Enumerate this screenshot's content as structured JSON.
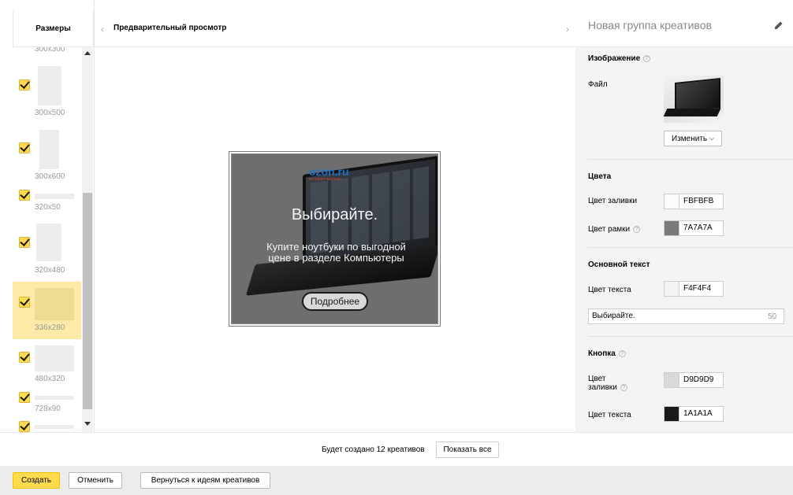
{
  "sizes_panel": {
    "title": "Размеры",
    "items": [
      {
        "label": "300x300",
        "checked": true,
        "selected": false
      },
      {
        "label": "300x500",
        "checked": true,
        "selected": false
      },
      {
        "label": "300x600",
        "checked": true,
        "selected": false
      },
      {
        "label": "320x50",
        "checked": true,
        "selected": false
      },
      {
        "label": "320x480",
        "checked": true,
        "selected": false
      },
      {
        "label": "336x280",
        "checked": true,
        "selected": true
      },
      {
        "label": "480x320",
        "checked": true,
        "selected": false
      },
      {
        "label": "728x90",
        "checked": true,
        "selected": false
      },
      {
        "label": "",
        "checked": true,
        "selected": false
      }
    ]
  },
  "preview": {
    "title": "Предварительный просмотр",
    "prev_icon": "chevron-left-icon",
    "next_icon": "chevron-right-icon",
    "ad": {
      "logo": "ozon.ru",
      "logo_sub": "интернет-магазин",
      "headline": "Выбирайте.",
      "body": "Купите ноутбуки по выгодной цене в разделе Компьютеры",
      "button": "Подробнее",
      "fill_color": "#FBFBFB",
      "border_color": "#7A7A7A",
      "text_color": "#F4F4F4",
      "button_fill": "#D9D9D9",
      "button_text": "#1A1A1A"
    }
  },
  "settings": {
    "title": "Новая группа креативов",
    "edit_icon": "pencil-icon",
    "image": {
      "section_title": "Изображение",
      "file_label": "Файл",
      "change_button": "Изменить"
    },
    "colors": {
      "section_title": "Цвета",
      "fill_label": "Цвет заливки",
      "fill_value": "FBFBFB",
      "border_label": "Цвет рамки",
      "border_value": "7A7A7A"
    },
    "main_text": {
      "section_title": "Основной текст",
      "color_label": "Цвет текста",
      "color_value": "F4F4F4",
      "text_value": "Выбирайте.",
      "counter": "50"
    },
    "button": {
      "section_title": "Кнопка",
      "fill_label_1": "Цвет",
      "fill_label_2": "заливки",
      "fill_value": "D9D9D9",
      "text_label": "Цвет текста",
      "text_value": "1A1A1A"
    }
  },
  "summary": {
    "text": "Будет создано 12 креативов",
    "show_all": "Показать все"
  },
  "footer": {
    "create": "Создать",
    "cancel": "Отменить",
    "back": "Вернуться к идеям креативов"
  }
}
